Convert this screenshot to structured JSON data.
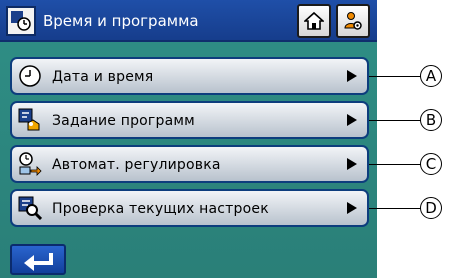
{
  "header": {
    "title": "Время и программа",
    "title_icon": "clock-program-icon",
    "home_icon": "home-icon",
    "settings_icon": "user-settings-icon"
  },
  "menu": [
    {
      "label": "Дата и время",
      "icon": "clock-icon",
      "callout": "A"
    },
    {
      "label": "Задание программ",
      "icon": "program-edit-icon",
      "callout": "B"
    },
    {
      "label": "Автомат. регулировка",
      "icon": "auto-adjust-icon",
      "callout": "C"
    },
    {
      "label": "Проверка текущих настроек",
      "icon": "check-settings-icon",
      "callout": "D"
    }
  ],
  "footer": {
    "back_icon": "return-icon"
  },
  "colors": {
    "screen_bg": "#2f8f86",
    "titlebar_bg": "#1f4fa8",
    "menu_border": "#0d3d7d",
    "back_button_bg": "#2a65cf"
  }
}
